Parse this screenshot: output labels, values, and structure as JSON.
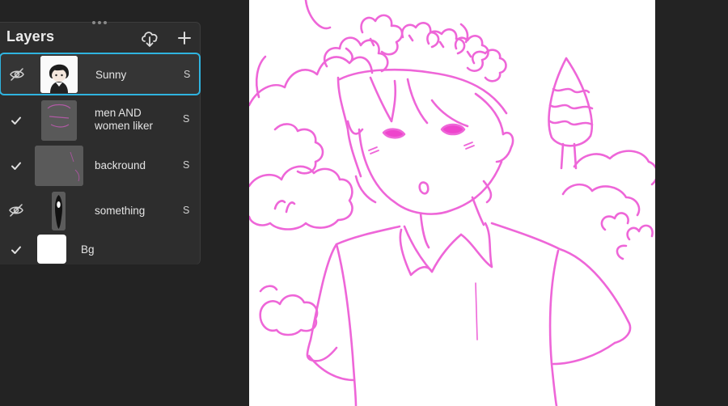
{
  "layers_panel": {
    "title": "Layers",
    "icons": {
      "drag_handle": "drag-handle-icon",
      "cloud": "cloud-download-icon",
      "add": "plus-icon",
      "hidden": "eye-hidden-icon",
      "visible": "checkmark-icon"
    },
    "layers": [
      {
        "name_line1": "Sunny",
        "name_line2": "",
        "blend": "S",
        "visible": false,
        "selected": true
      },
      {
        "name_line1": "men AND",
        "name_line2": "women liker",
        "blend": "S",
        "visible": true,
        "selected": false
      },
      {
        "name_line1": "backround",
        "name_line2": "",
        "blend": "S",
        "visible": true,
        "selected": false
      },
      {
        "name_line1": "something",
        "name_line2": "",
        "blend": "S",
        "visible": false,
        "selected": false
      },
      {
        "name_line1": "Bg",
        "name_line2": "",
        "blend": "",
        "visible": true,
        "selected": false
      }
    ]
  },
  "colors": {
    "background": "#232323",
    "panel": "#2d2d2d",
    "selection_accent": "#2fb4e0",
    "sketch_pink": "#ee55d6",
    "canvas": "#ffffff"
  }
}
